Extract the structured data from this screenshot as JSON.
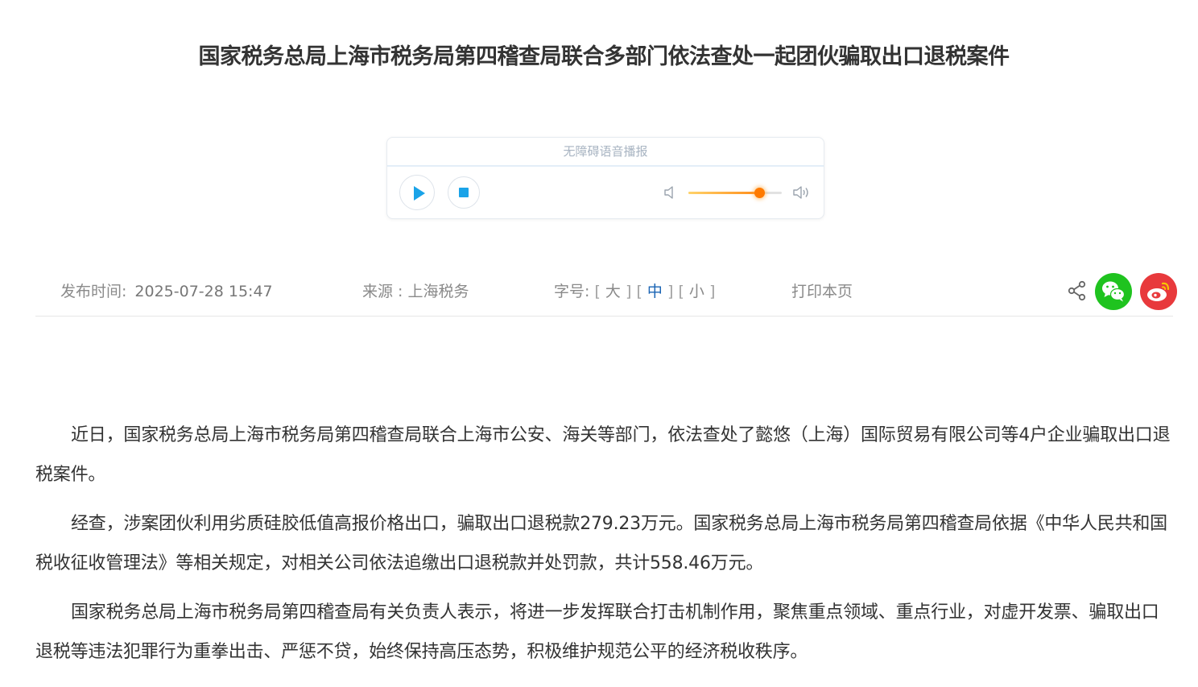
{
  "article": {
    "title": "国家税务总局上海市税务局第四稽查局联合多部门依法查处一起团伙骗取出口退税案件",
    "paragraphs": [
      "近日，国家税务总局上海市税务局第四稽查局联合上海市公安、海关等部门，依法查处了懿悠（上海）国际贸易有限公司等4户企业骗取出口退税案件。",
      "经查，涉案团伙利用劣质硅胶低值高报价格出口，骗取出口退税款279.23万元。国家税务总局上海市税务局第四稽查局依据《中华人民共和国税收征收管理法》等相关规定，对相关公司依法追缴出口退税款并处罚款，共计558.46万元。",
      "国家税务总局上海市税务局第四稽查局有关负责人表示，将进一步发挥联合打击机制作用，聚焦重点领域、重点行业，对虚开发票、骗取出口退税等违法犯罪行为重拳出击、严惩不贷，始终保持高压态势，积极维护规范公平的经济税收秩序。"
    ]
  },
  "audio_player": {
    "header": "无障碍语音播报",
    "play_icon": "play-icon",
    "stop_icon": "stop-icon",
    "volume_level": 0.76,
    "accent_color": "#1aa3e8",
    "volume_color": "#ff7a00"
  },
  "meta": {
    "date_label": "发布时间:",
    "date_value": "2025-07-28 15:47",
    "source": "来源 : 上海税务",
    "font_size_label": "字号:",
    "bracket_open": "[",
    "bracket_close": "]",
    "size_large": "大",
    "size_medium": "中",
    "size_small": "小",
    "print": "打印本页"
  },
  "share": {
    "share_icon": "share-icon",
    "wechat_icon": "wechat-icon",
    "weibo_icon": "weibo-icon",
    "wechat_color": "#1fc31f",
    "weibo_color": "#e8393c"
  }
}
